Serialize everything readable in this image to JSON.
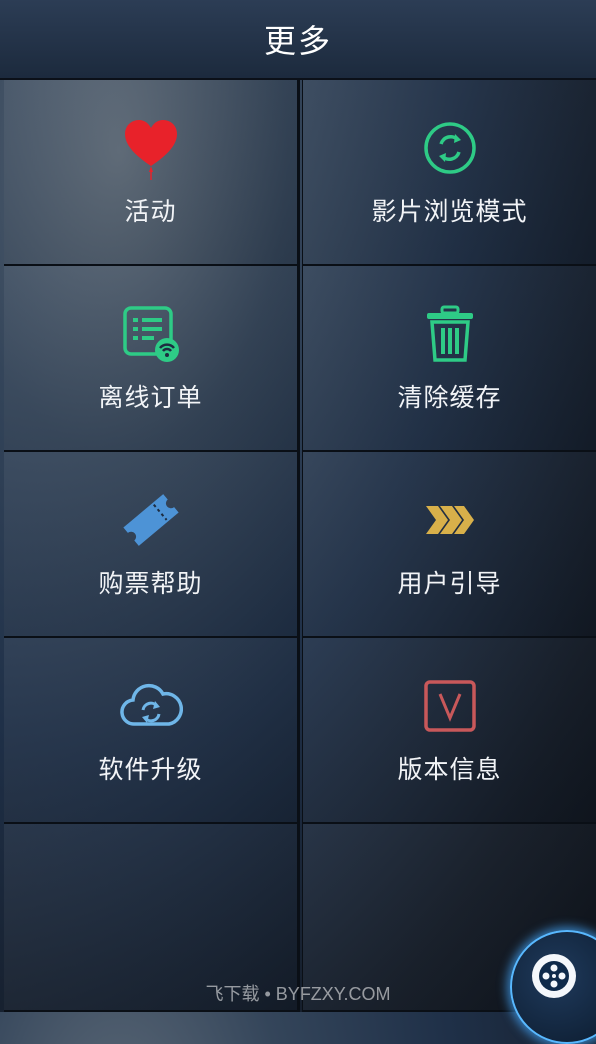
{
  "header": {
    "title": "更多"
  },
  "menu": {
    "items": [
      {
        "label": "活动",
        "icon": "heart-balloon-icon",
        "color": "#e8222a"
      },
      {
        "label": "影片浏览模式",
        "icon": "refresh-circle-icon",
        "color": "#2ecb86"
      },
      {
        "label": "离线订单",
        "icon": "offline-order-icon",
        "color": "#2ecb86"
      },
      {
        "label": "清除缓存",
        "icon": "trash-icon",
        "color": "#2ecb86"
      },
      {
        "label": "购票帮助",
        "icon": "ticket-icon",
        "color": "#4d93d6"
      },
      {
        "label": "用户引导",
        "icon": "chevrons-right-icon",
        "color": "#d8b04a"
      },
      {
        "label": "软件升级",
        "icon": "cloud-sync-icon",
        "color": "#6fb6e8"
      },
      {
        "label": "版本信息",
        "icon": "version-v-icon",
        "color": "#c8585a"
      }
    ]
  },
  "watermark": "飞下载 • BYFZXY.COM"
}
